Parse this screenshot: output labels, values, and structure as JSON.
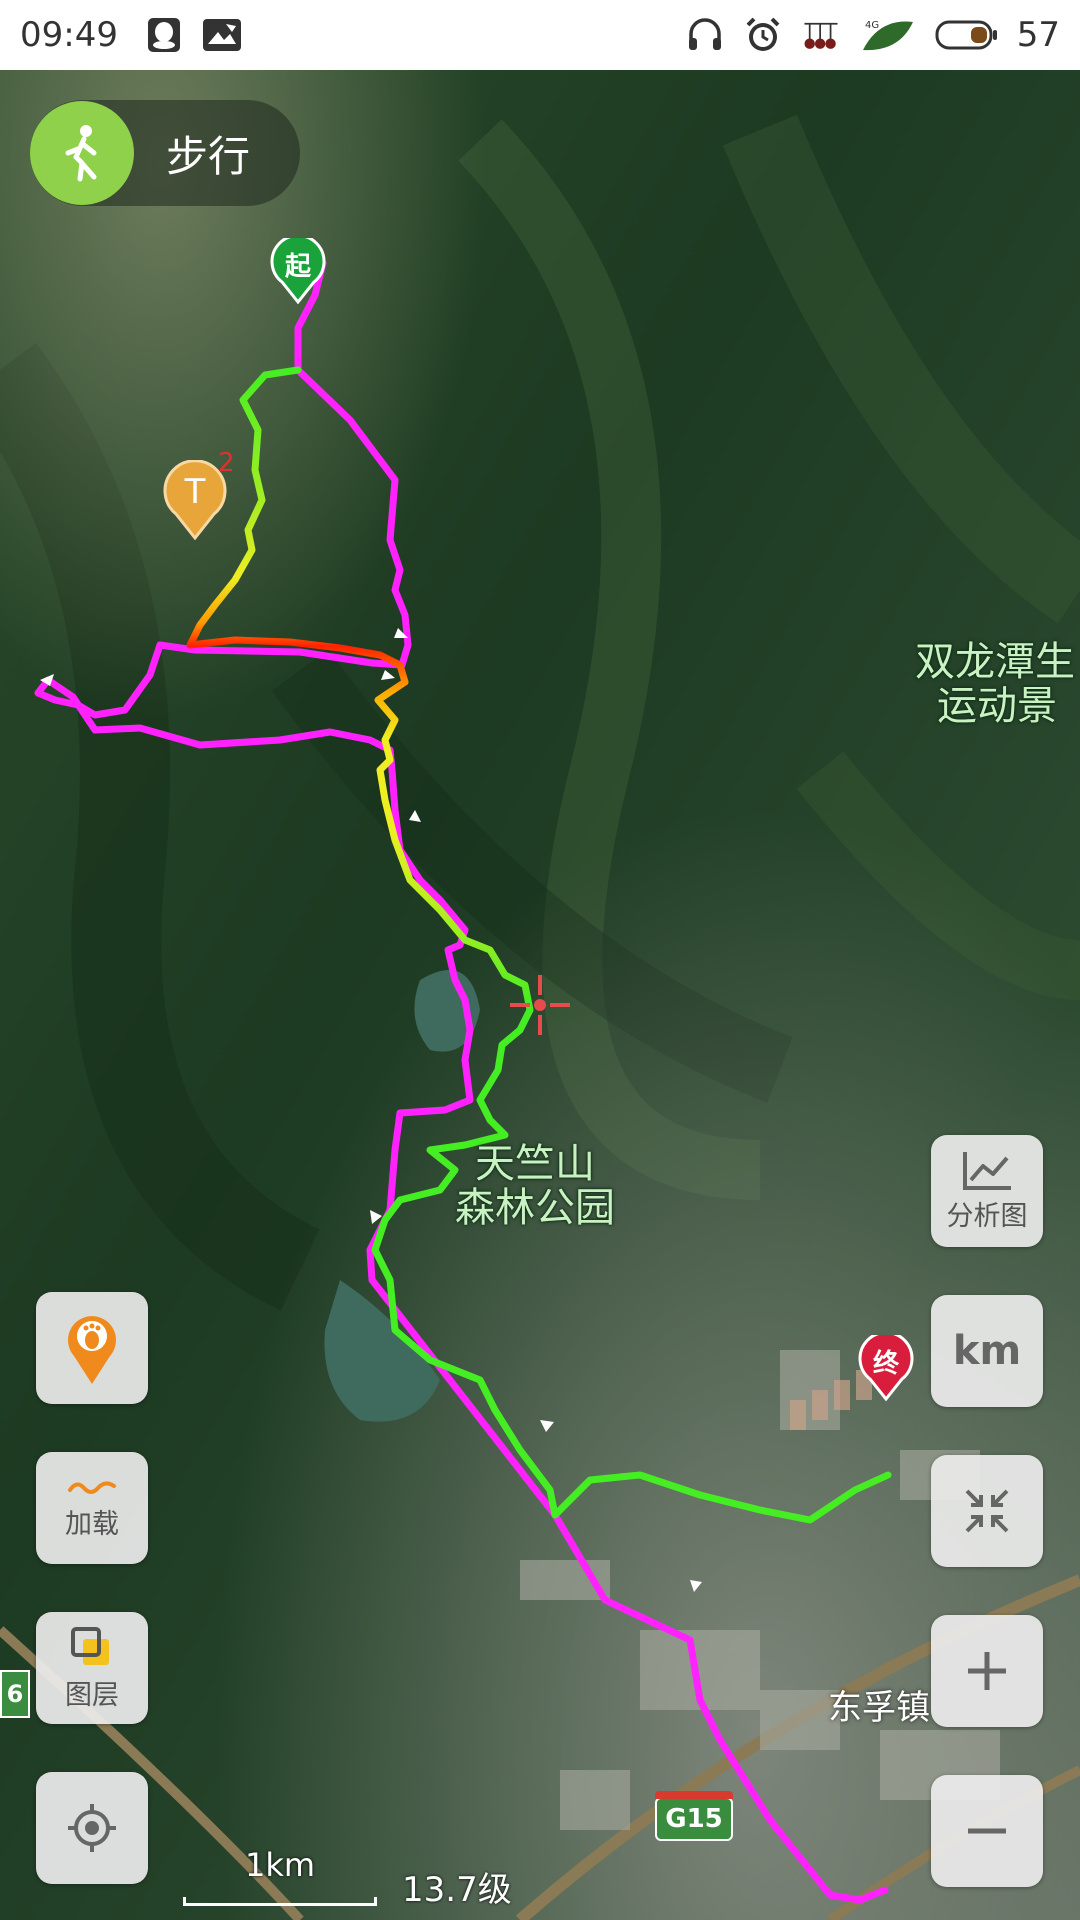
{
  "status_bar": {
    "time": "09:49",
    "battery_level": "57",
    "left_icons": [
      "qq-icon",
      "image-notification-icon"
    ],
    "right_icons": [
      "headphones-icon",
      "alarm-icon",
      "network-icon",
      "4g-signal-icon",
      "battery-icon"
    ]
  },
  "mode": {
    "label": "步行",
    "icon": "walking-icon"
  },
  "markers": {
    "start": "起",
    "end": "终",
    "waypoint": "T",
    "waypoint_count": "2"
  },
  "places": {
    "park": [
      "天竺山",
      "森林公园"
    ],
    "scenic": [
      "双龙潭生",
      "运动景"
    ],
    "town": "东孚镇"
  },
  "road_badges": {
    "g15": "G15",
    "left": "6"
  },
  "buttons": {
    "analysis": "分析图",
    "unit": "km",
    "load": "加载",
    "layers": "图层"
  },
  "scale": {
    "label": "1km",
    "zoom": "13.7级"
  },
  "colors": {
    "track_return": "#ff22ff",
    "track_green": "#44ee22",
    "track_yellow": "#eeee22",
    "track_red": "#ff2200",
    "start_marker": "#1aa33a",
    "end_marker": "#d81e3c",
    "waypoint_marker": "#e8a53a"
  }
}
